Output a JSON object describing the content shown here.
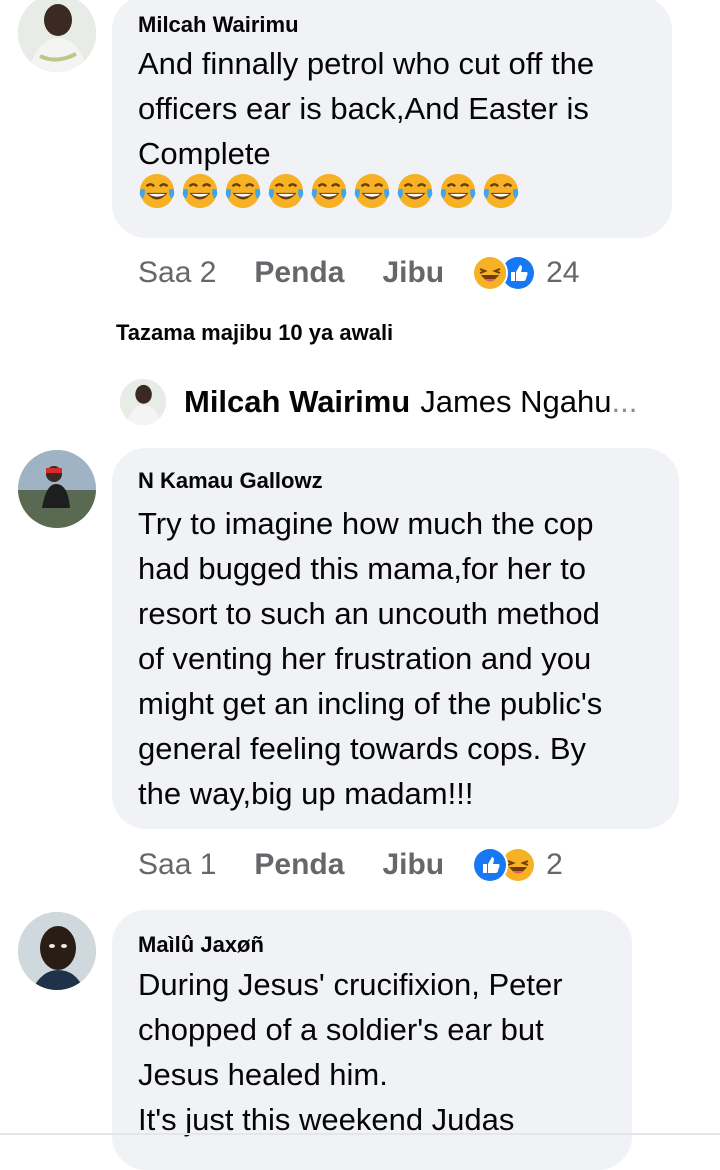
{
  "comments": [
    {
      "author": "Milcah Wairimu",
      "text": "And finnally petrol who cut off the\nofficers ear is back,And Easter is\nComplete",
      "emoji": "face-with-tears-of-joy",
      "emoji_count": 9,
      "time": "Saa 2",
      "like_label": "Penda",
      "reply_label": "Jibu",
      "reactions": [
        "laugh-reaction",
        "like-reaction"
      ],
      "reaction_count": "24"
    },
    {
      "author": "N Kamau Gallowz",
      "text": "Try to imagine how much the cop\nhad bugged this mama,for her to\nresort to such an uncouth method\nof venting her frustration and you\nmight get an incling of the public's\ngeneral feeling towards cops. By\nthe way,big up madam!!!",
      "time": "Saa 1",
      "like_label": "Penda",
      "reply_label": "Jibu",
      "reactions": [
        "like-reaction",
        "laugh-reaction"
      ],
      "reaction_count": "2"
    },
    {
      "author": "Maìlû Jaxøñ",
      "text": "During Jesus' crucifixion, Peter\nchopped of a soldier's ear but\nJesus healed him.\nIt's just this weekend Judas"
    }
  ],
  "view_replies": "Tazama majibu 10 ya awali",
  "reply_preview": {
    "author": "Milcah Wairimu",
    "text": "James Ngahu",
    "ellipsis": "..."
  },
  "colors": {
    "bubble": "#f0f2f5",
    "secondary_text": "#65676b",
    "like_blue": "#1877f2",
    "laugh_yellow": "#f7b125"
  }
}
